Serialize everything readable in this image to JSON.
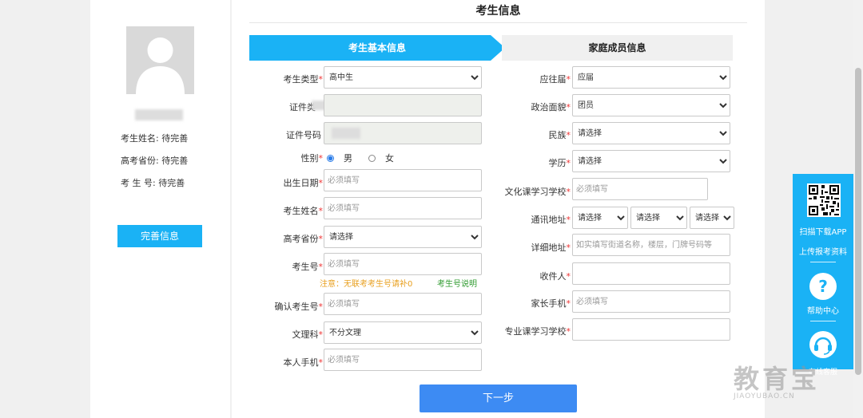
{
  "page_title": "考生信息",
  "left_panel": {
    "name_line": "考生姓名: 待完善",
    "province_line": "高考省份: 待完善",
    "exam_no_line": "考 生 号: 待完善",
    "complete_button": "完善信息"
  },
  "steps": {
    "active": "考生基本信息",
    "inactive": "家庭成员信息"
  },
  "form_left": {
    "student_type": {
      "label": "考生类型",
      "value": "高中生"
    },
    "id_type": {
      "label": "证件类"
    },
    "id_number": {
      "label": "证件号码"
    },
    "gender": {
      "label": "性别",
      "option_male": "男",
      "option_female": "女"
    },
    "birth_date": {
      "label": "出生日期",
      "placeholder": "必须填写"
    },
    "student_name": {
      "label": "考生姓名",
      "placeholder": "必须填写"
    },
    "exam_province": {
      "label": "高考省份",
      "value": "请选择"
    },
    "exam_number": {
      "label": "考生号",
      "placeholder": "必须填写",
      "note": "注意：无联考考生号请补0",
      "note_link": "考生号说明"
    },
    "confirm_exam_number": {
      "label": "确认考生号",
      "placeholder": "必须填写"
    },
    "arts_science": {
      "label": "文理科",
      "value": "不分文理"
    },
    "own_phone": {
      "label": "本人手机",
      "placeholder": "必须填写"
    }
  },
  "form_right": {
    "graduate_year": {
      "label": "应往届",
      "value": "应届"
    },
    "political_status": {
      "label": "政治面貌",
      "value": "团员"
    },
    "ethnicity": {
      "label": "民族",
      "value": "请选择"
    },
    "education": {
      "label": "学历",
      "value": "请选择"
    },
    "culture_school": {
      "label": "文化课学习学校",
      "placeholder": "必须填写"
    },
    "mail_address": {
      "label": "通讯地址",
      "province": "请选择",
      "city": "请选择",
      "district": "请选择"
    },
    "detail_address": {
      "label": "详细地址",
      "placeholder": "如实填写街道名称，楼层，门牌号码等"
    },
    "recipient": {
      "label": "收件人"
    },
    "parent_phone": {
      "label": "家长手机",
      "placeholder": "必须填写"
    },
    "major_school": {
      "label": "专业课学习学校"
    }
  },
  "next_button": "下一步",
  "side_panel": {
    "download_app": "扫描下载APP",
    "upload_docs": "上传报考资料",
    "help_center": "帮助中心",
    "online_service": "在线客服"
  },
  "watermark": {
    "big": "教育宝",
    "small": "JIAOYUBAO.CN"
  },
  "colors": {
    "accent": "#1ab2f5",
    "next_button": "#3d8bf3",
    "required": "#e33333"
  }
}
